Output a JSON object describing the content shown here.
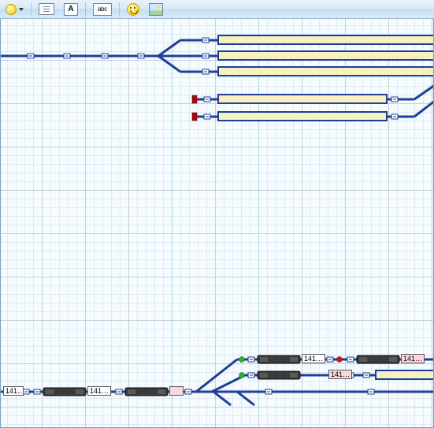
{
  "toolbar": {
    "yellow_dropdown": "circle-marker",
    "btn_textbox": "textbox",
    "btn_textframe": "A",
    "btn_abc_box": "abc",
    "btn_smiley": "smiley",
    "btn_picture": "picture"
  },
  "blocks": {
    "upper_siding_count": 5,
    "lower_labels": {
      "a": "141…",
      "b": "141…",
      "c": "141…",
      "d": "141…"
    }
  },
  "colors": {
    "track_blue": "#1d3f9c",
    "track_yellow": "#f5f0b6",
    "signal_red": "#b3000a",
    "signal_green": "#1f9a1f",
    "loco_dark": "#3a3a3a",
    "label_pink": "#ffd6dc"
  }
}
